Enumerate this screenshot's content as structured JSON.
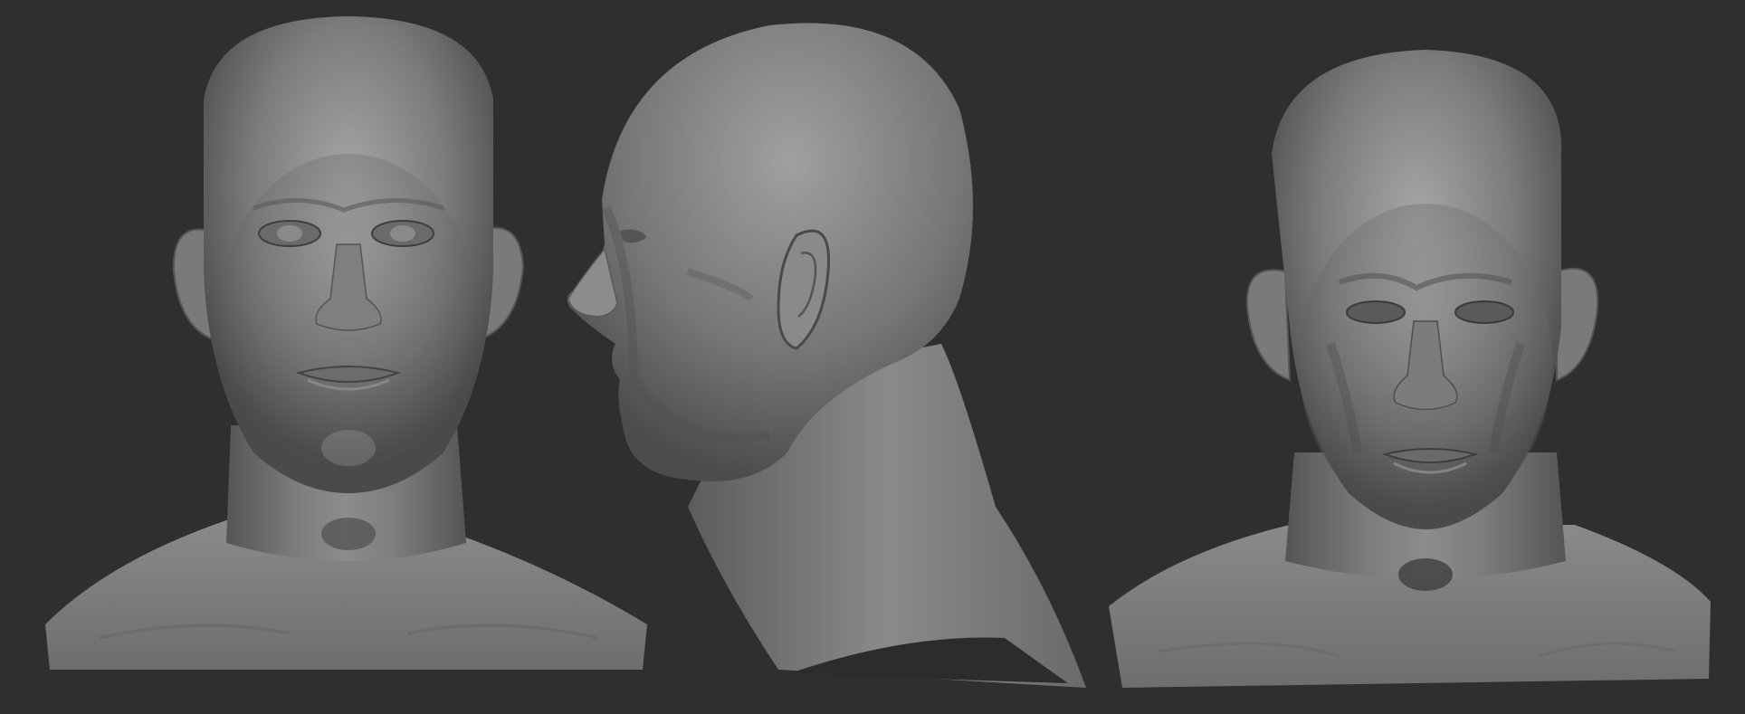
{
  "scene": {
    "background_color": "#2f2f2f",
    "clay_color": "#8a8a8a",
    "views": [
      {
        "name": "front-view",
        "kind": "front"
      },
      {
        "name": "side-view",
        "kind": "profile-left"
      },
      {
        "name": "three-quarter-front-view",
        "kind": "front-variant"
      }
    ]
  }
}
